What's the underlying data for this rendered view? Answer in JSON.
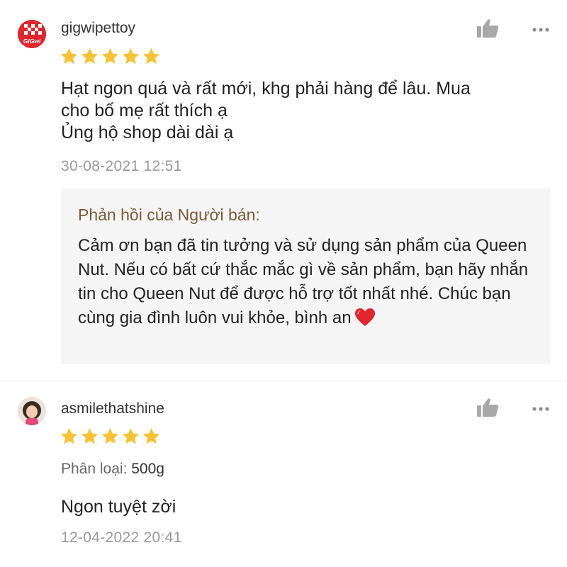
{
  "reviews": [
    {
      "username": "gigwipettoy",
      "avatar_text": "GiGwi",
      "rating": 5,
      "comment": "Hạt ngon quá và rất mới, khg phải hàng để lâu. Mua\ncho bố mẹ rất thích ạ\nỦng hộ shop dài dài ạ",
      "timestamp": "30-08-2021 12:51",
      "seller_reply": {
        "title": "Phản hồi của Người bán:",
        "text": "Cảm ơn bạn đã tin tưởng và sử dụng sản phẩm của Queen Nut. Nếu có bất cứ thắc mắc gì về sản phẩm, bạn hãy nhắn tin cho Queen Nut để được hỗ trợ tốt nhất nhé. Chúc bạn cùng gia đình luôn vui khỏe, bình an"
      }
    },
    {
      "username": "asmilethatshine",
      "rating": 5,
      "variant_label": "Phân loại:",
      "variant_value": "500g",
      "comment": "Ngon tuyệt zời",
      "timestamp": "12-04-2022 20:41"
    }
  ],
  "icons": {
    "like": "thumbs-up-icon",
    "more": "more-dots-icon",
    "star": "star-icon",
    "heart": "red-heart-emoji"
  },
  "colors": {
    "star": "#f6c338",
    "reply_title": "#7a5b3a",
    "timestamp": "#9a9a9a",
    "reply_background": "#f5f5f5",
    "heart": "#e0262e"
  }
}
